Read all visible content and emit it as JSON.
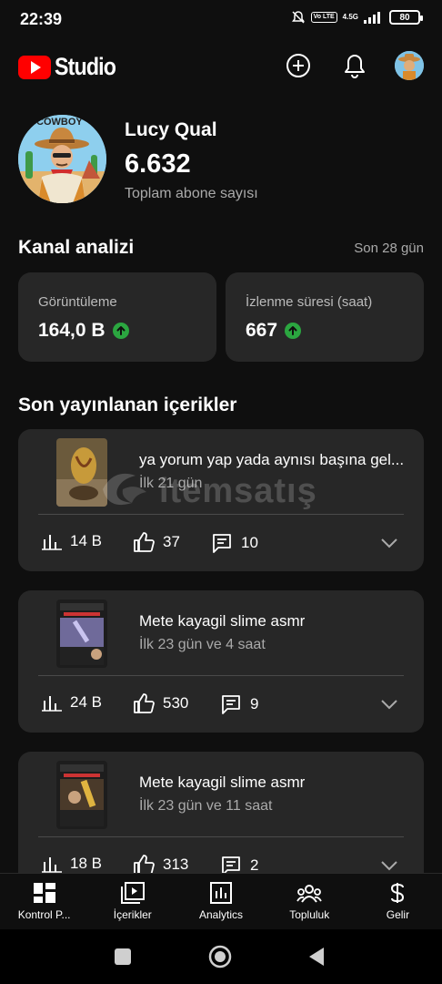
{
  "status_bar": {
    "time": "22:39",
    "network": "4.5G",
    "volte": "Vo LTE",
    "battery": "80"
  },
  "header": {
    "logo_text": "Studio",
    "icons": [
      "create-icon",
      "bell-icon",
      "account-avatar"
    ]
  },
  "channel": {
    "avatar_caption": "COWBOY",
    "name": "Lucy Qual",
    "subscribers": "6.632",
    "subscribers_label": "Toplam abone sayısı"
  },
  "analytics": {
    "title": "Kanal analizi",
    "period": "Son 28 gün",
    "cards": [
      {
        "label": "Görüntüleme",
        "value": "164,0 B",
        "trend": "up"
      },
      {
        "label": "İzlenme süresi (saat)",
        "value": "667",
        "trend": "up"
      }
    ]
  },
  "recent": {
    "title": "Son yayınlanan içerikler",
    "videos": [
      {
        "title": "ya yorum yap yada aynısı başına gel...",
        "age": "İlk 21 gün",
        "views": "14 B",
        "likes": "37",
        "comments": "10"
      },
      {
        "title": "Mete kayagil slime asmr",
        "age": "İlk 23 gün ve 4 saat",
        "views": "24 B",
        "likes": "530",
        "comments": "9"
      },
      {
        "title": "Mete kayagil slime asmr",
        "age": "İlk 23 gün ve 11 saat",
        "views": "18 B",
        "likes": "313",
        "comments": "2"
      }
    ]
  },
  "watermark": "itemsatış",
  "bottom_nav": [
    {
      "label": "Kontrol P...",
      "icon": "dashboard-icon"
    },
    {
      "label": "İçerikler",
      "icon": "content-icon"
    },
    {
      "label": "Analytics",
      "icon": "analytics-icon"
    },
    {
      "label": "Topluluk",
      "icon": "community-icon"
    },
    {
      "label": "Gelir",
      "icon": "earn-icon"
    }
  ],
  "colors": {
    "background": "#0f0f0f",
    "card": "#272727",
    "brand_red": "#ff0000",
    "trend_green": "#2ba640",
    "secondary_text": "#aaaaaa"
  }
}
